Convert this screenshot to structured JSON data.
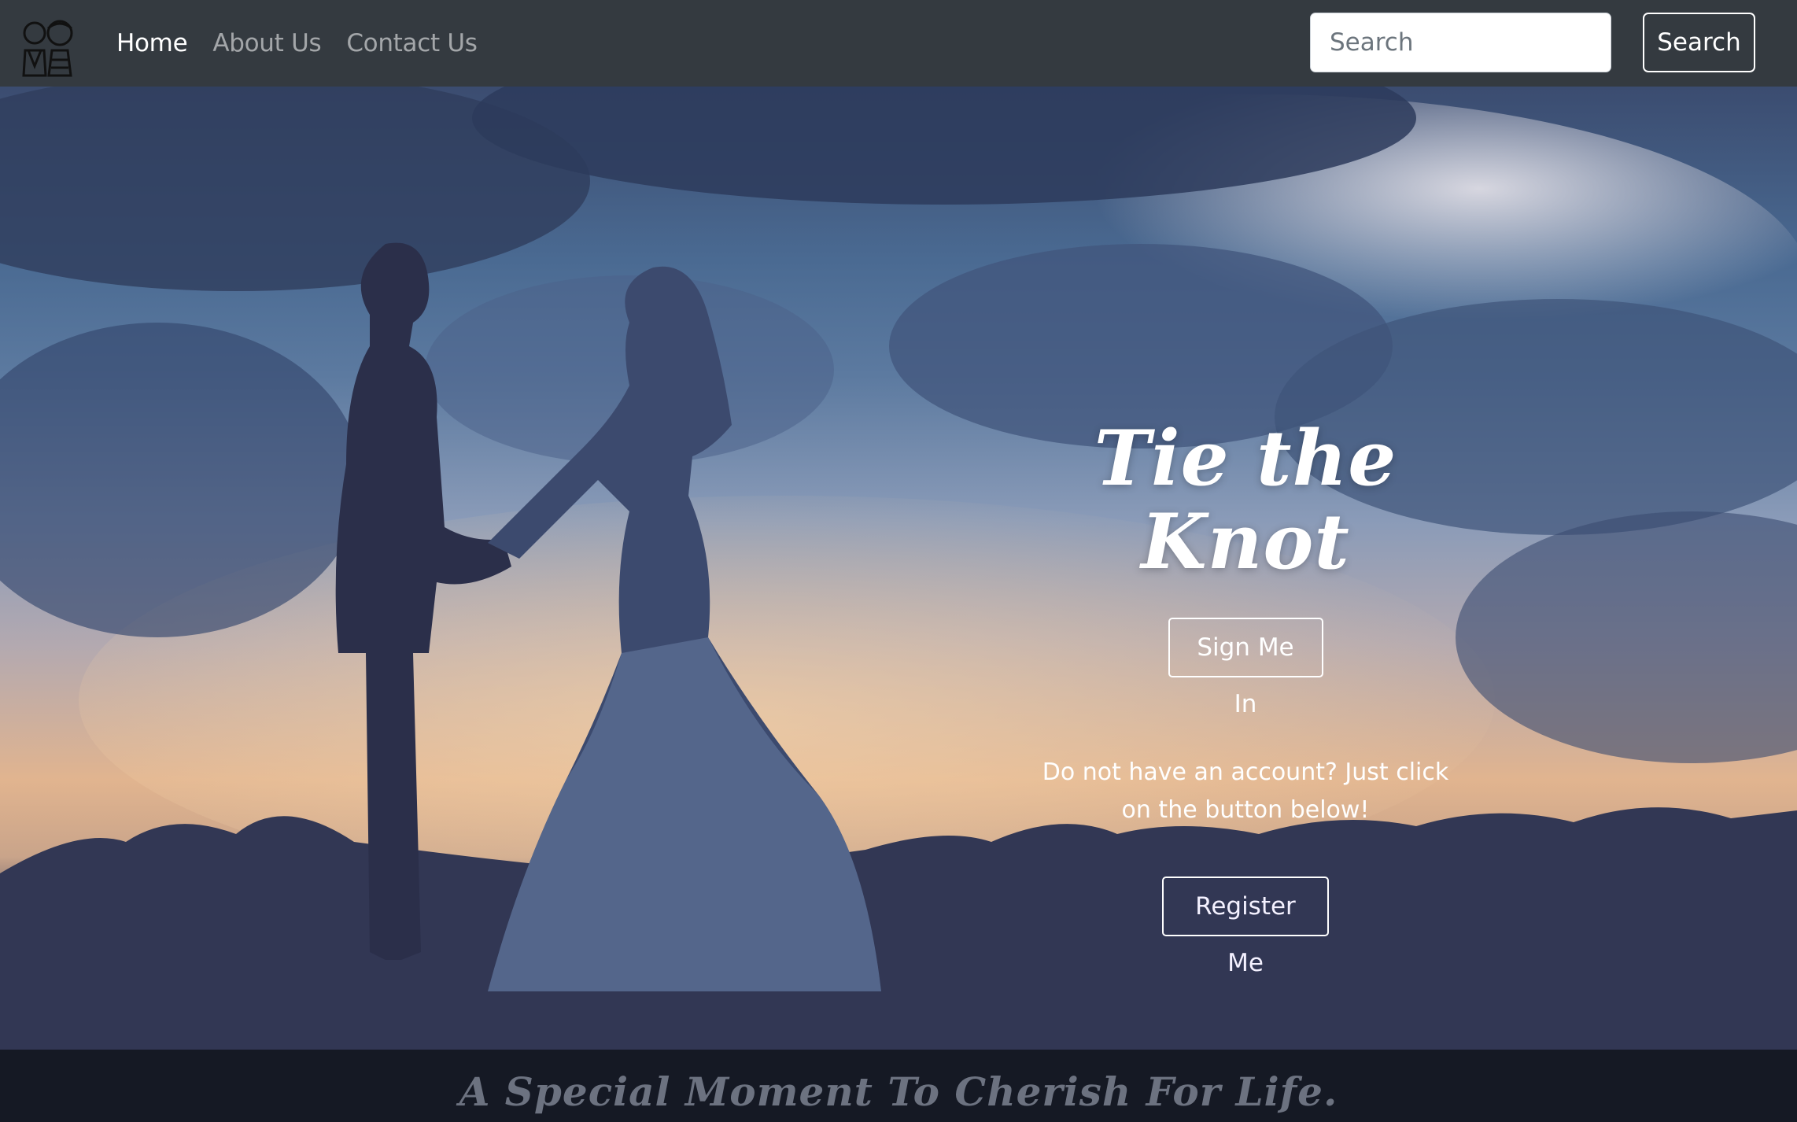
{
  "nav": {
    "logo_icon": "bride-groom-logo-icon",
    "links": [
      {
        "label": "Home",
        "active": true
      },
      {
        "label": "About Us",
        "active": false
      },
      {
        "label": "Contact Us",
        "active": false
      }
    ],
    "search": {
      "placeholder": "Search",
      "button_label": "Search"
    }
  },
  "hero": {
    "title": "Tie the Knot",
    "signin_label": "Sign Me In",
    "register_prompt": "Do not have an account? Just click on the button below!",
    "register_label": "Register Me",
    "background": "wedding-couple-silhouette-sunset-photo"
  },
  "footer": {
    "tagline": "A Special Moment To Cherish For Life."
  },
  "colors": {
    "navbar_bg": "#343a40",
    "footer_bg": "#151924",
    "tagline": "#6c7280",
    "nav_inactive": "rgba(255,255,255,0.55)"
  }
}
